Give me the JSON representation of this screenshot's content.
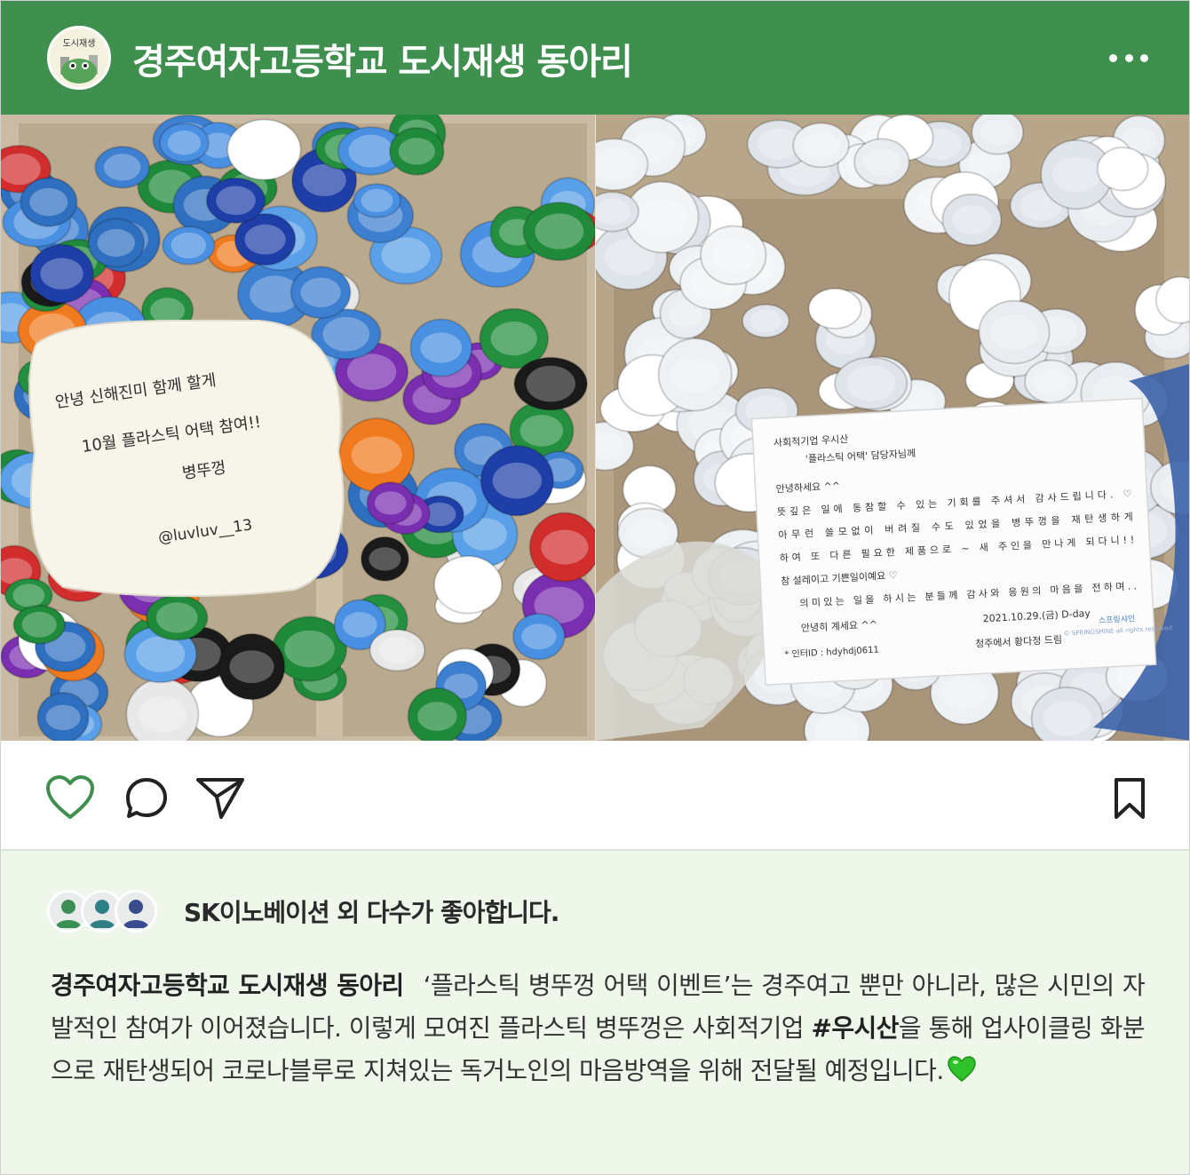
{
  "header": {
    "title": "경주여자고등학교 도시재생 동아리",
    "avatar_label": "도시재생",
    "more_icon": "more-horizontal-icon"
  },
  "photos": {
    "left_note": {
      "line1": "안녕 신해진미 함께 할게",
      "line2": "10월 플라스틱 어택 참여!!",
      "line3": "병뚜껑",
      "handle": "@luvluv__13"
    },
    "right_letter": {
      "l1": "사회적기업 우시산",
      "l2": "'플라스틱 어택' 담당자님께",
      "l3": "안녕하세요 ^^",
      "l4": "뜻깊은 일에 동참할 수 있는 기회를 주셔서 감사드립니다. ♡",
      "l5": "아무런 쓸모없이 버려질 수도 있었을 병뚜껑을 재탄생하게",
      "l6": "하여 또 다른 필요한 제품으로 ~ 새 주인을 만나게 되다니!!",
      "l7": "참 설레이고 기쁜일이예요 ♡",
      "l8": "의미있는 일을 하시는 분들께 감사와 응원의 마음을 전하며..",
      "l9": "안녕히 계세요 ^^",
      "date": "2021.10.29.(금) D-day",
      "sign": "청주에서 황다정 드림",
      "id": "* 인터ID : hdyhdj0611",
      "brand": "스프링샤인",
      "copyright": "© SPRINGSHINE all rights reserved"
    }
  },
  "actions": {
    "like_icon": "heart-icon",
    "comment_icon": "comment-icon",
    "share_icon": "send-icon",
    "save_icon": "bookmark-icon"
  },
  "likes": {
    "text": "SK이노베이션 외 다수가 좋아합니다."
  },
  "caption": {
    "author": "경주여자고등학교 도시재생 동아리",
    "part1": "‘플라스틱 병뚜껑 어택 이벤트’는 경주여고 뿐만 아니라, 많은 시민의 자발적인 참여가 이어졌습니다. 이렇게 모여진 플라스틱 병뚜껑은 사회적기업 ",
    "hashtag": "#우시산",
    "part2": "을 통해 업사이클링 화분으로 재탄생되어 코로나블루로 지쳐있는 독거노인의 마음방역을 위해 전달될 예정입니다.",
    "emoji": "green-heart-icon"
  },
  "colors": {
    "brand_green": "#3f8f4f",
    "caption_bg": "#eef7ea"
  }
}
